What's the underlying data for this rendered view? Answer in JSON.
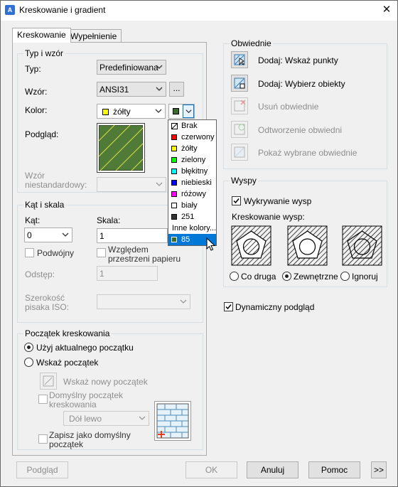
{
  "window": {
    "title": "Kreskowanie i gradient",
    "close_glyph": "✕"
  },
  "tabs": [
    {
      "label": "Kreskowanie",
      "active": true
    },
    {
      "label": "Wypełnienie",
      "active": false
    }
  ],
  "type_pattern": {
    "legend": "Typ i wzór",
    "type_label": "Typ:",
    "type_value": "Predefiniowana",
    "pattern_label": "Wzór:",
    "pattern_value": "ANSI31",
    "browse_label": "...",
    "color_label": "Kolor:",
    "color_value": "żółty",
    "color_swatch": "#ffff00",
    "color2_swatch": "#3b6b2e",
    "preview_label": "Podgląd:",
    "preview_fill": "#4f7a37",
    "preview_lines": "#d8e046",
    "custom_label": "Wzór niestandardowy:"
  },
  "color_menu": {
    "items": [
      {
        "label": "Brak",
        "color": "none"
      },
      {
        "label": "czerwony",
        "color": "#ff0000"
      },
      {
        "label": "żółty",
        "color": "#ffff00"
      },
      {
        "label": "zielony",
        "color": "#00ff00"
      },
      {
        "label": "błękitny",
        "color": "#00ffff"
      },
      {
        "label": "niebieski",
        "color": "#0000ff"
      },
      {
        "label": "różowy",
        "color": "#ff00ff"
      },
      {
        "label": "biały",
        "color": "#ffffff"
      },
      {
        "label": "251",
        "color": "#333333"
      },
      {
        "label": "Inne kolory...",
        "color": ""
      },
      {
        "label": "85",
        "color": "#3b6b2e",
        "selected": true
      }
    ]
  },
  "angle_scale": {
    "legend": "Kąt i skala",
    "angle_label": "Kąt:",
    "angle_value": "0",
    "scale_label": "Skala:",
    "scale_value": "1",
    "double_label": "Podwójny",
    "paper_label": "Względem przestrzeni papieru",
    "spacing_label": "Odstęp:",
    "spacing_value": "1",
    "iso_label": "Szerokość pisaka ISO:"
  },
  "origin": {
    "legend": "Początek kreskowania",
    "use_current": "Użyj aktualnego początku",
    "specified": "Wskaż początek",
    "click_new": "Wskaż nowy początek",
    "default_boundary": "Domyślny początek kreskowania",
    "position_value": "Dół lewo",
    "store_default": "Zapisz jako domyślny początek"
  },
  "boundaries": {
    "legend": "Obwiednie",
    "add_points": "Dodaj: Wskaż punkty",
    "add_objects": "Dodaj: Wybierz obiekty",
    "remove": "Usuń obwiednie",
    "recreate": "Odtworzenie obwiedni",
    "view_selections": "Pokaż wybrane obwiednie"
  },
  "islands": {
    "legend": "Wyspy",
    "detection_label": "Wykrywanie wysp",
    "style_label": "Kreskowanie wysp:",
    "normal": "Co druga",
    "outer": "Zewnętrzne",
    "ignore": "Ignoruj"
  },
  "dynamic_preview": "Dynamiczny podgląd",
  "footer": {
    "preview": "Podgląd",
    "ok": "OK",
    "cancel": "Anuluj",
    "help": "Pomoc",
    "more": ">>"
  }
}
